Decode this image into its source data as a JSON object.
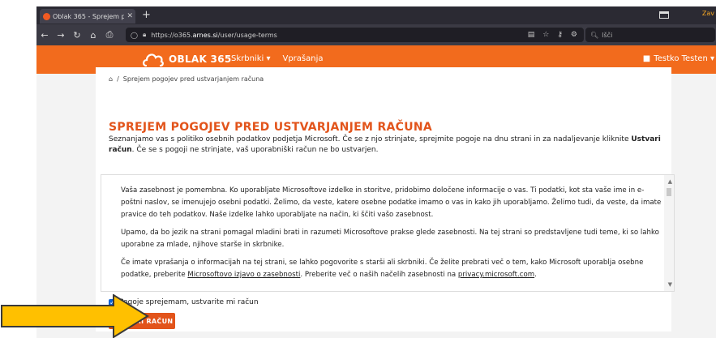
{
  "browser": {
    "tab_title": "Oblak 365 - Sprejem pogojev p",
    "tab_close": "✕",
    "new_tab": "+",
    "profile_label": "Zav",
    "url_host": "https://o365.",
    "url_domain": "arnes.si",
    "url_path": "/user/usage-terms",
    "search_placeholder": "Išči"
  },
  "site": {
    "logo_text": "OBLAK 365",
    "menu": [
      "Skrbniki ▾",
      "Vprašanja"
    ],
    "user_name": "Testko Testen ▾"
  },
  "breadcrumb": {
    "separator": "/",
    "current": "Sprejem pogojev pred ustvarjanjem računa"
  },
  "page": {
    "heading": "SPREJEM POGOJEV PRED USTVARJANJEM RAČUNA",
    "intro_part1": "Seznanjamo vas s politiko osebnih podatkov podjetja Microsoft. Če se z njo strinjate, sprejmite pogoje na dnu strani in za nadaljevanje kliknite ",
    "intro_bold": "Ustvari račun",
    "intro_part2": ". Če se s pogoji ne strinjate, vaš uporabniški račun ne bo ustvarjen."
  },
  "terms": {
    "p1": "Vaša zasebnost je pomembna. Ko uporabljate Microsoftove izdelke in storitve, pridobimo določene informacije o vas. Ti podatki, kot sta vaše ime in e-poštni naslov, se imenujejo osebni podatki. Želimo, da veste, katere osebne podatke imamo o vas in kako jih uporabljamo. Želimo tudi, da veste, da imate pravice do teh podatkov. Naše izdelke lahko uporabljate na način, ki ščiti vašo zasebnost.",
    "p2": "Upamo, da bo jezik na strani pomagal mladini brati in razumeti Microsoftove prakse glede zasebnosti. Na tej strani so predstavljene tudi teme, ki so lahko uporabne za mlade, njihove starše in skrbnike.",
    "p3_a": "Če imate vprašanja o informacijah na tej strani, se lahko pogovorite s starši ali skrbniki. Če želite prebrati več o tem, kako Microsoft uporablja osebne podatke, preberite ",
    "p3_link1": "Microsoftovo izjavo o zasebnosti",
    "p3_b": ". Preberite več o naših načelih zasebnosti na ",
    "p3_link2": "privacy.microsoft.com",
    "p3_c": "."
  },
  "form": {
    "accept_label": "Pogoje sprejemam, ustvarite mi račun",
    "accept_checked": true,
    "submit_label": "USTVARI RAČUN"
  },
  "colors": {
    "brand_orange": "#f26b1d",
    "heading_orange": "#e2541b",
    "arrow_yellow": "#ffc000"
  }
}
